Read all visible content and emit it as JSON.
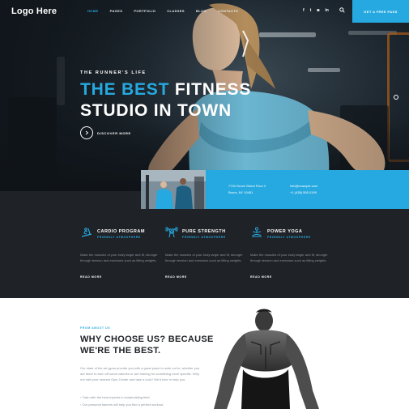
{
  "header": {
    "logo": "Logo Here",
    "nav": [
      "HOME",
      "PAGES",
      "PORTFOLIO",
      "CLASSES",
      "BLOG",
      "CONTACTS"
    ],
    "active_nav": "HOME",
    "socials": [
      "f",
      "t",
      "◙",
      "in"
    ],
    "cta_label": "GET A FREE PASS"
  },
  "hero": {
    "eyebrow": "THE RUNNER'S LIFE",
    "headline_accent": "THE BEST",
    "headline_rest": " FITNESS",
    "headline_line2": "STUDIO IN TOWN",
    "discover_label": "DISCOVER MORE"
  },
  "info": {
    "address_line1": "7734 Grove Street Floor 2",
    "address_line2": "Bronx, NY 10451",
    "email": "info@example.com",
    "phone": "+1 (438) 555 0199"
  },
  "features": [
    {
      "title": "CARDIO PROGRAM",
      "subtitle": "FRIENDLY ATMOSPHERE",
      "desc": "Make the muscles of your body larger and fit, stronger through tension and exercises such as lifting weights.",
      "more": "READ MORE",
      "icon": "treadmill-icon"
    },
    {
      "title": "PURE STRENGTH",
      "subtitle": "FRIENDLY ATMOSPHERE",
      "desc": "Make the muscles of your body larger and fit, stronger through tension and exercises such as lifting weights.",
      "more": "READ MORE",
      "icon": "weightlifter-icon"
    },
    {
      "title": "POWER YOGA",
      "subtitle": "FRIENDLY ATMOSPHERE",
      "desc": "Make the muscles of your body larger and fit, stronger through tension and exercises such as lifting weights.",
      "more": "READ MORE",
      "icon": "yoga-icon"
    }
  ],
  "why": {
    "eyebrow": "FROM ABOUT US",
    "heading_line1": "WHY CHOOSE US? BECAUSE",
    "heading_line2": "WE'RE THE BEST.",
    "paragraph": "Our state of the art gyms provide you with a great place to work out in, whether you are there to burn off some calories or are training for something more specific. Why not visit your nearest Gym Center and take a look? We'd love to help you.",
    "bullets": [
      "Train with the best experts in bodybuilding field.",
      "Our personal trainers will help you find a perfect workout."
    ]
  },
  "colors": {
    "accent": "#26a9e0",
    "dark": "#1f2227",
    "white": "#ffffff",
    "muted": "#8b949b"
  }
}
